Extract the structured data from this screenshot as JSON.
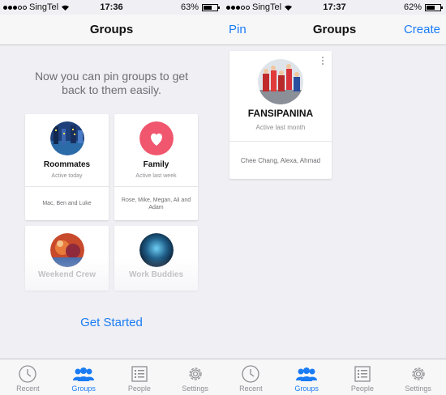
{
  "left": {
    "status": {
      "carrier": "SingTel",
      "time": "17:36",
      "battery": "63%",
      "battery_level": 0.63
    },
    "nav": {
      "title": "Groups"
    },
    "prompt": "Now you can pin groups to get back to them easily.",
    "cards": [
      {
        "name": "Roommates",
        "active": "Active today",
        "members": "Mac, Ben and Luke"
      },
      {
        "name": "Family",
        "active": "Active last week",
        "members": "Rose, Mike, Megan, Ali and Adam"
      },
      {
        "name": "Weekend Crew"
      },
      {
        "name": "Work Buddies"
      }
    ],
    "get_started": "Get Started",
    "tabs": [
      {
        "label": "Recent",
        "icon": "clock-icon"
      },
      {
        "label": "Groups",
        "icon": "groups-icon"
      },
      {
        "label": "People",
        "icon": "people-list-icon"
      },
      {
        "label": "Settings",
        "icon": "gear-icon"
      }
    ],
    "active_tab": "Groups"
  },
  "right": {
    "status": {
      "carrier": "SingTel",
      "time": "17:37",
      "battery": "62%",
      "battery_level": 0.62
    },
    "nav": {
      "left_button": "Pin",
      "title": "Groups",
      "right_button": "Create"
    },
    "group": {
      "name": "FANSIPANINA",
      "active": "Active last month",
      "members": "Chee Chang, Alexa, Ahmad"
    },
    "tabs": [
      {
        "label": "Recent",
        "icon": "clock-icon"
      },
      {
        "label": "Groups",
        "icon": "groups-icon"
      },
      {
        "label": "People",
        "icon": "people-list-icon"
      },
      {
        "label": "Settings",
        "icon": "gear-icon"
      }
    ],
    "active_tab": "Groups"
  },
  "colors": {
    "accent": "#1a7cf4",
    "family_avatar": "#f0566d",
    "background": "#efeff4"
  }
}
